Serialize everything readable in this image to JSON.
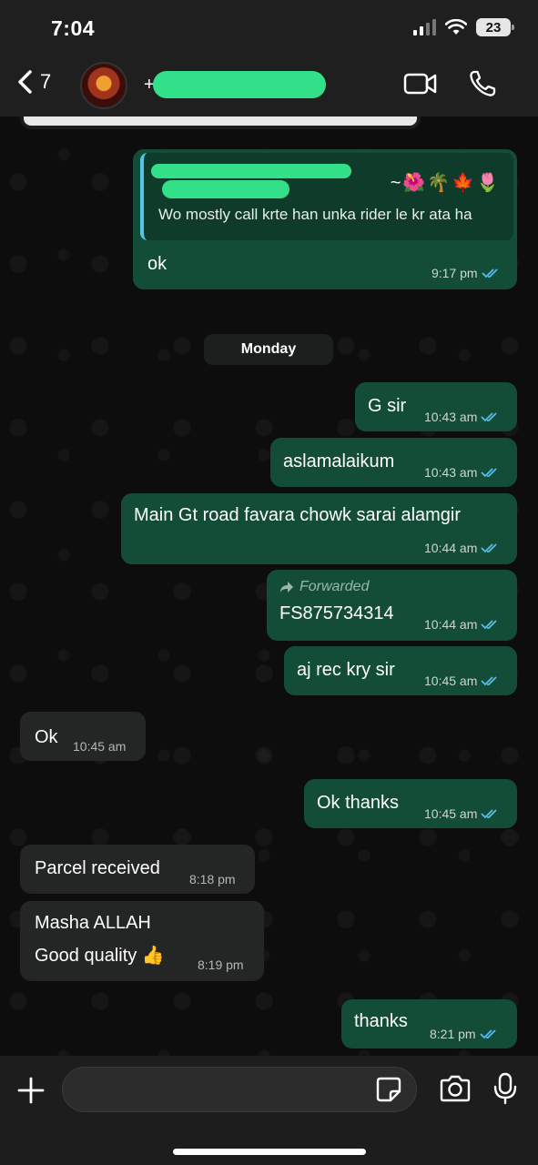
{
  "status_bar": {
    "time": "7:04",
    "battery": "23"
  },
  "header": {
    "back_count": "7",
    "contact_prefix": "+"
  },
  "icons": {
    "back": "chevron-left-icon",
    "video": "video-camera-icon",
    "phone": "phone-icon",
    "plus": "plus-icon",
    "sticker": "sticker-icon",
    "camera": "camera-icon",
    "mic": "microphone-icon"
  },
  "colors": {
    "outgoing_bubble": "#144d37",
    "incoming_bubble": "#242626",
    "read_ticks": "#53bdeb",
    "redaction": "#33e08a"
  },
  "messages": {
    "m1": {
      "quote_emojis": "~🌺🌴🍁🌷",
      "quote_text": "Wo mostly call krte han unka rider le kr ata ha",
      "text": "ok",
      "time": "9:17 pm"
    },
    "day_separator": "Monday",
    "m2": {
      "text": "G sir",
      "time": "10:43 am"
    },
    "m3": {
      "text": "aslamalaikum",
      "time": "10:43 am"
    },
    "m4": {
      "text": "Main Gt road favara chowk sarai alamgir",
      "time": "10:44 am"
    },
    "m5": {
      "forwarded_label": "Forwarded",
      "text": "FS875734314",
      "time": "10:44 am"
    },
    "m6": {
      "text": "aj rec kry sir",
      "time": "10:45 am"
    },
    "m7": {
      "text": "Ok",
      "time": "10:45 am"
    },
    "m8": {
      "text": "Ok thanks",
      "time": "10:45 am"
    },
    "m9": {
      "text": "Parcel received",
      "time": "8:18 pm"
    },
    "m10": {
      "line1": "Masha ALLAH",
      "line2": "Good quality 👍",
      "time": "8:19 pm"
    },
    "m11": {
      "text": "thanks",
      "time": "8:21 pm"
    }
  },
  "input": {
    "value": ""
  }
}
